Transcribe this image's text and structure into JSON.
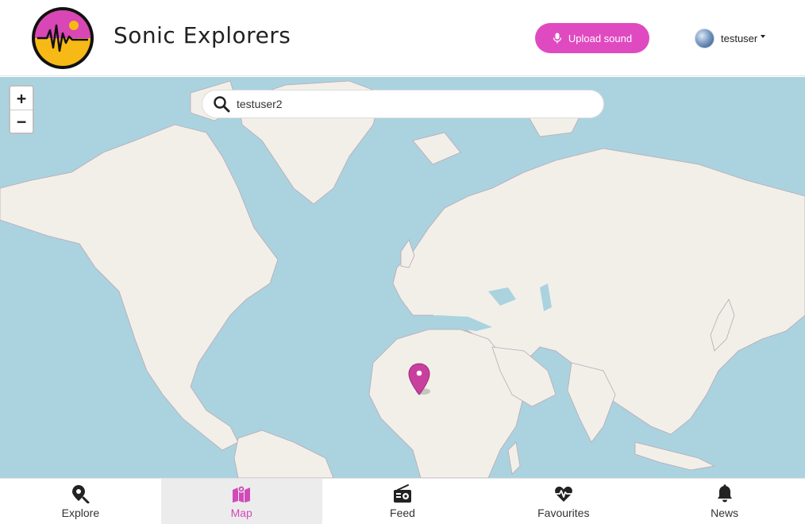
{
  "header": {
    "brand": "Sonic Explorers",
    "upload_label": "Upload sound",
    "username": "testuser"
  },
  "map": {
    "search": {
      "value": "testuser2"
    },
    "zoom_in": "+",
    "zoom_out": "−"
  },
  "nav": {
    "items": [
      {
        "label": "Explore",
        "icon": "map-pin-search-icon"
      },
      {
        "label": "Map",
        "icon": "map-icon"
      },
      {
        "label": "Feed",
        "icon": "radio-icon"
      },
      {
        "label": "Favourites",
        "icon": "heart-pulse-icon"
      },
      {
        "label": "News",
        "icon": "bell-icon"
      }
    ],
    "active": "Map"
  },
  "colors": {
    "accent": "#e04ac0",
    "ocean": "#aad3df",
    "land": "#f2efe9",
    "marker": "#c93f9e"
  }
}
